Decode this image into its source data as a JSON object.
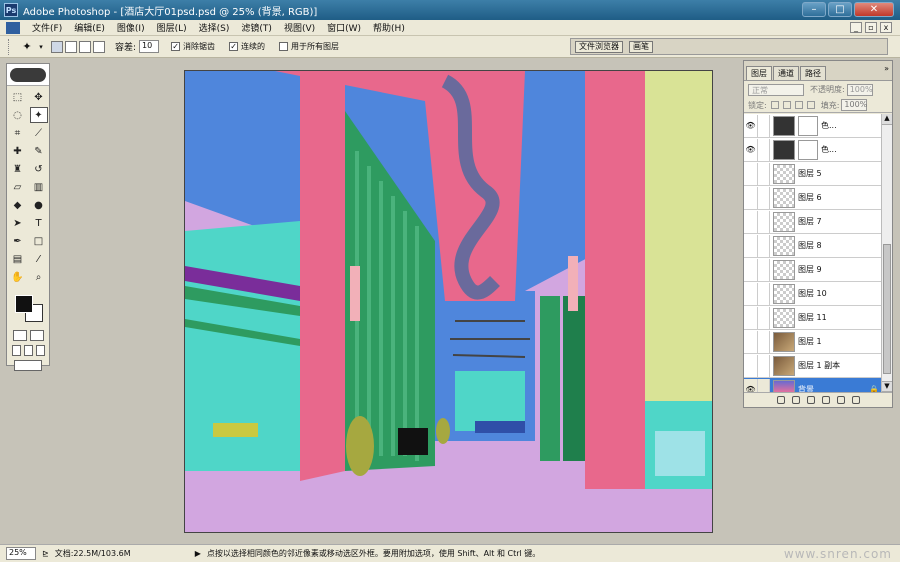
{
  "window": {
    "app_name": "Adobe Photoshop",
    "doc_title": "[酒店大厅01psd.psd @ 25% (背景, RGB)]"
  },
  "menu": [
    "文件(F)",
    "编辑(E)",
    "图像(I)",
    "图层(L)",
    "选择(S)",
    "滤镜(T)",
    "视图(V)",
    "窗口(W)",
    "帮助(H)"
  ],
  "options": {
    "tolerance_label": "容差:",
    "tolerance_value": "10",
    "anti_alias": "消除锯齿",
    "contiguous": "连续的",
    "all_layers": "用于所有图层"
  },
  "palette_well": {
    "file_browser": "文件浏览器",
    "brushes": "画笔"
  },
  "layers_panel": {
    "tabs": [
      "图层",
      "通道",
      "路径"
    ],
    "blend_mode": "正常",
    "opacity_label": "不透明度:",
    "opacity_value": "100%",
    "lock_label": "锁定:",
    "fill_label": "填充:",
    "fill_value": "100%",
    "layers": [
      {
        "name": "色...",
        "kind": "adjust"
      },
      {
        "name": "色...",
        "kind": "adjust"
      },
      {
        "name": "图层 5",
        "kind": "layer"
      },
      {
        "name": "图层 6",
        "kind": "layer"
      },
      {
        "name": "图层 7",
        "kind": "layer"
      },
      {
        "name": "图层 8",
        "kind": "layer"
      },
      {
        "name": "图层 9",
        "kind": "layer"
      },
      {
        "name": "图层 10",
        "kind": "layer"
      },
      {
        "name": "图层 11",
        "kind": "layer"
      },
      {
        "name": "图层 1",
        "kind": "photo"
      },
      {
        "name": "图层 1 副本",
        "kind": "photo"
      },
      {
        "name": "背景",
        "kind": "background",
        "selected": true
      }
    ]
  },
  "status": {
    "zoom": "25%",
    "doc_size": "文档:22.5M/103.6M",
    "tip": "点按以选择相同颜色的邻近像素或移动选区外框。要用附加选项，使用 Shift、Alt 和 Ctrl 键。"
  },
  "watermark": "www.snren.com",
  "colors": {
    "canvas_pink": "#e8688c",
    "canvas_blue": "#4f86dc",
    "canvas_cyan": "#4fd6c8",
    "canvas_green": "#2e9b60",
    "canvas_lavender": "#d2a6e0",
    "canvas_yellow": "#d9e396"
  }
}
